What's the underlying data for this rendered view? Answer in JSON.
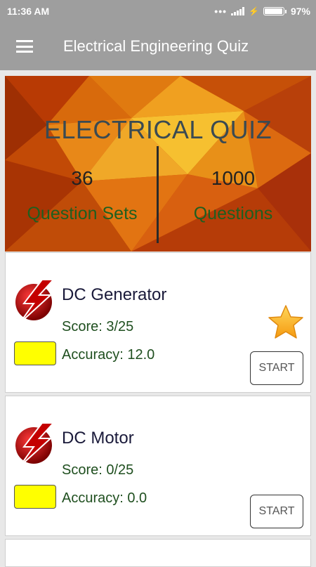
{
  "status_bar": {
    "time": "11:36 AM",
    "dots": "•••",
    "battery_pct": "97%",
    "battery_level": 0.97
  },
  "app_bar": {
    "title": "Electrical Engineering Quiz"
  },
  "hero": {
    "title": "ELECTRICAL QUIZ",
    "sets_count": "36",
    "sets_label": "Question Sets",
    "questions_count": "1000",
    "questions_label": "Questions"
  },
  "quizzes": [
    {
      "title": "DC Generator",
      "score": "Score: 3/25",
      "accuracy": "Accuracy: 12.0",
      "start_label": "START",
      "starred": true
    },
    {
      "title": "DC Motor",
      "score": "Score: 0/25",
      "accuracy": "Accuracy: 0.0",
      "start_label": "START",
      "starred": false
    }
  ],
  "colors": {
    "appbar": "#9e9e9e",
    "accuracy_box": "#ffff00",
    "label_green": "#1f5f1f"
  }
}
